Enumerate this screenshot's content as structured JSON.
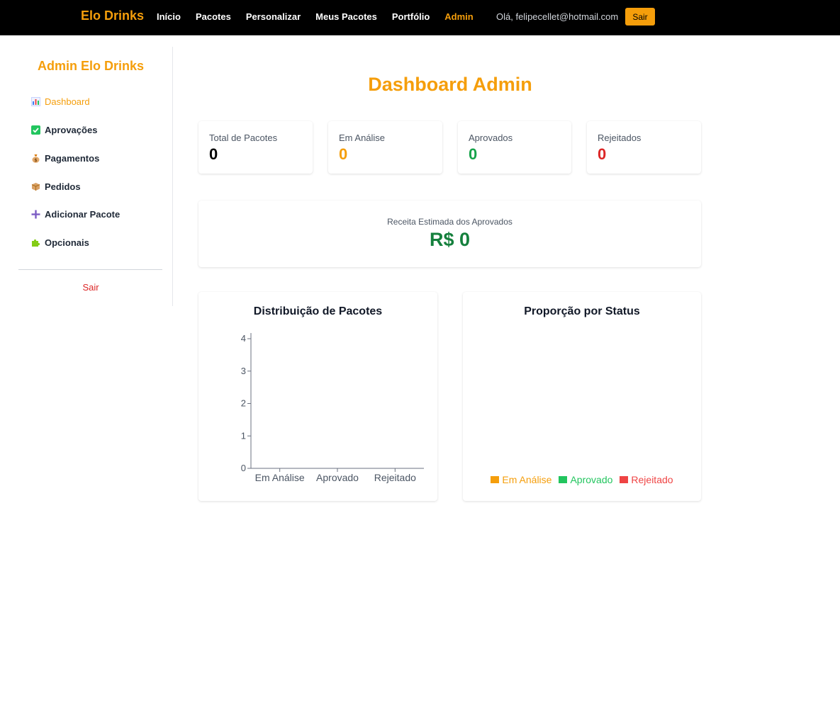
{
  "navbar": {
    "brand": "Elo Drinks",
    "links": [
      "Início",
      "Pacotes",
      "Personalizar",
      "Meus Pacotes",
      "Portfólio",
      "Admin"
    ],
    "active_link": "Admin",
    "greeting": "Olá, felipecellet@hotmail.com",
    "logout_label": "Sair",
    "accent_color": "#f59e0b"
  },
  "sidebar": {
    "title": "Admin Elo Drinks",
    "items": [
      {
        "label": "Dashboard",
        "icon": "bar-chart-icon"
      },
      {
        "label": "Aprovações",
        "icon": "check-box-icon"
      },
      {
        "label": "Pagamentos",
        "icon": "money-bag-icon"
      },
      {
        "label": "Pedidos",
        "icon": "package-icon"
      },
      {
        "label": "Adicionar Pacote",
        "icon": "plus-icon"
      },
      {
        "label": "Opcionais",
        "icon": "puzzle-icon"
      }
    ],
    "active_item": "Dashboard",
    "logout_label": "Sair"
  },
  "main": {
    "title": "Dashboard Admin",
    "stats": [
      {
        "label": "Total de Pacotes",
        "value": "0",
        "color": "#000000"
      },
      {
        "label": "Em Análise",
        "value": "0",
        "color": "#f59e0b"
      },
      {
        "label": "Aprovados",
        "value": "0",
        "color": "#16a34a"
      },
      {
        "label": "Rejeitados",
        "value": "0",
        "color": "#dc2626"
      }
    ],
    "revenue": {
      "label": "Receita Estimada dos Aprovados",
      "value": "R$ 0"
    }
  },
  "chart_data": [
    {
      "type": "bar",
      "title": "Distribuição de Pacotes",
      "categories": [
        "Em Análise",
        "Aprovado",
        "Rejeitado"
      ],
      "values": [
        0,
        0,
        0
      ],
      "yticks": [
        0,
        1,
        2,
        3,
        4
      ],
      "ylim": [
        0,
        4
      ],
      "xlabel": "",
      "ylabel": ""
    },
    {
      "type": "pie",
      "title": "Proporção por Status",
      "labels": [
        "Em Análise",
        "Aprovado",
        "Rejeitado"
      ],
      "values": [
        0,
        0,
        0
      ],
      "colors": [
        "#f59e0b",
        "#22c55e",
        "#ef4444"
      ],
      "legend": "bottom"
    }
  ]
}
